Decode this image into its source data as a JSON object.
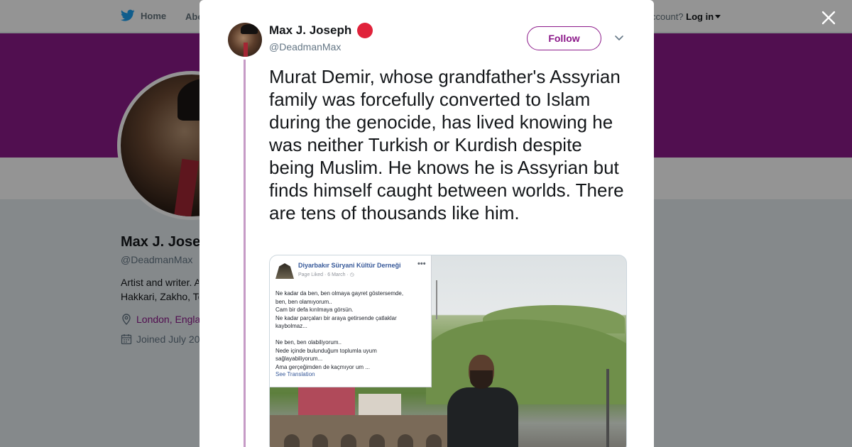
{
  "nav": {
    "home_label": "Home",
    "about_label": "Abo",
    "account_prompt": "ccount?",
    "login_label": "Log in"
  },
  "profile": {
    "name": "Max J. Jose",
    "handle": "@DeadmanMax",
    "bio_line1": "Artist and writer. A",
    "bio_line2": "Hakkari, Zakho, Te",
    "location": "London, Engla",
    "joined": "Joined July 20",
    "accent_color": "#8c1a8a"
  },
  "tweet": {
    "display_name": "Max J. Joseph",
    "handle": "@DeadmanMax",
    "follow_label": "Follow",
    "text": "Murat Demir, whose grandfather's Assyrian family was forcefully converted to Islam during the genocide, has lived knowing he was neither Turkish or Kurdish despite being Muslim. He knows he is Assyrian but finds himself caught between worlds. There are tens of thousands like him."
  },
  "media": {
    "fb_page_name": "Diyarbakır Süryani Kültür Derneği",
    "fb_meta": "Page Liked · 6 March · ◷",
    "fb_text": "Ne kadar da ben, ben olmaya gayret göstersemde,\nben, ben olamıyorum..\nCam bir defa kırılmaya görsün.\nNe kadar parçaları bir araya getirsende çatlaklar\nkaybolmaz...\n\nNe ben, ben olabiliyorum..\nNede içinde bulunduğum toplumla uyum\nsağlayabiliyorum...\nAma gerçeğimden de kaçmıyor um ...",
    "fb_link": "See Translation"
  },
  "icons": {
    "close": "close-icon",
    "chevron": "chevron-down-icon",
    "twitter": "twitter-bird-icon",
    "location": "location-pin-icon",
    "calendar": "calendar-icon"
  }
}
